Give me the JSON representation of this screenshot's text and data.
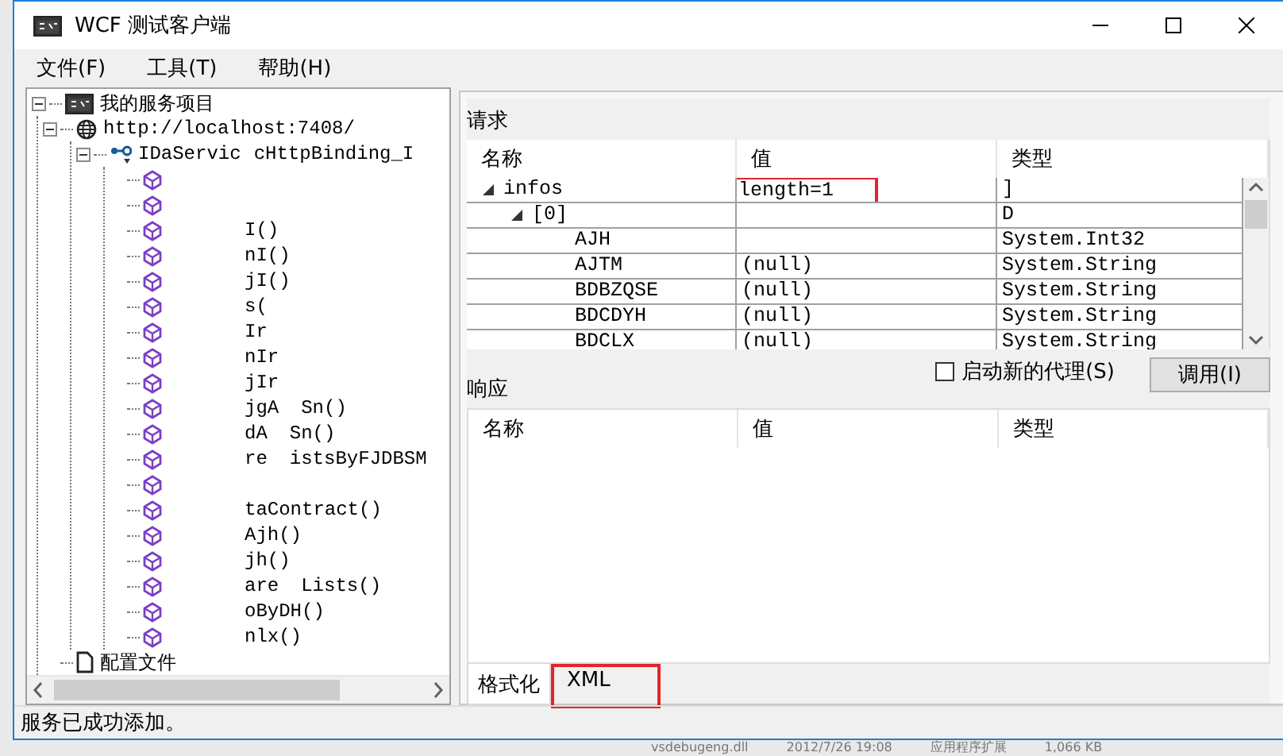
{
  "window": {
    "title": "WCF 测试客户端"
  },
  "menu": [
    "文件(F)",
    "工具(T)",
    "帮助(H)"
  ],
  "tree": {
    "label": "我的服务项目",
    "kind": "console",
    "expanded": true,
    "children": [
      {
        "label": "http://localhost:7408/",
        "kind": "globe",
        "expanded": true,
        "children": [
          {
            "label": "IDaServic",
            "tail": "cHttpBinding_I",
            "kind": "endpoint",
            "expanded": true,
            "children": [
              {
                "kind": "method"
              },
              {
                "kind": "method"
              },
              {
                "label": "I()",
                "kind": "method"
              },
              {
                "label": "nI()",
                "kind": "method"
              },
              {
                "label": "jI()",
                "kind": "method"
              },
              {
                "label": "s(",
                "kind": "method"
              },
              {
                "label": "Ir",
                "kind": "method"
              },
              {
                "label": "nIr",
                "kind": "method"
              },
              {
                "label": "jIr",
                "kind": "method"
              },
              {
                "label": "jgA",
                "tail": "Sn()",
                "kind": "method"
              },
              {
                "label": "dA",
                "tail": "Sn()",
                "kind": "method"
              },
              {
                "label": "re",
                "tail": "istsByFJDBSM",
                "kind": "method"
              },
              {
                "kind": "method"
              },
              {
                "label": "taContract()",
                "kind": "method"
              },
              {
                "label": "Ajh()",
                "kind": "method"
              },
              {
                "label": "jh()",
                "kind": "method"
              },
              {
                "label": "are",
                "tail": "Lists()",
                "kind": "method"
              },
              {
                "label": "oByDH()",
                "kind": "method"
              },
              {
                "label": "nlx()",
                "kind": "method"
              }
            ]
          }
        ]
      },
      {
        "label": "配置文件",
        "kind": "file"
      }
    ]
  },
  "request": {
    "title": "请求",
    "columns": [
      "名称",
      "值",
      "类型"
    ],
    "rows": [
      {
        "name": "infos",
        "value": "length=1",
        "type": "]",
        "expanded": true,
        "highlighted": true,
        "children": [
          {
            "name": "[0]",
            "type": "D",
            "expanded": true,
            "children": [
              {
                "name": "AJH",
                "type": "System.Int32"
              },
              {
                "name": "AJTM",
                "value": "(null)",
                "type": "System.String"
              },
              {
                "name": "BDBZQSE",
                "value": "(null)",
                "type": "System.String"
              },
              {
                "name": "BDCDYH",
                "value": "(null)",
                "type": "System.String"
              },
              {
                "name": "BDCLX",
                "value": "(null)",
                "type": "System.String"
              }
            ]
          }
        ]
      }
    ]
  },
  "proxy_option": {
    "label": "启动新的代理(S)",
    "checked": false
  },
  "invoke_button": "调用(I)",
  "response": {
    "title": "响应",
    "columns": [
      "名称",
      "值",
      "类型"
    ]
  },
  "view_tabs": [
    {
      "label": "格式化",
      "selected": true,
      "highlighted": false
    },
    {
      "label": "XML",
      "selected": false,
      "highlighted": true
    }
  ],
  "status_bar": "服务已成功添加。",
  "background_file": [
    "vsdebugeng.dll",
    "2012/7/26 19:08",
    "应用程序扩展",
    "1,066 KB"
  ]
}
